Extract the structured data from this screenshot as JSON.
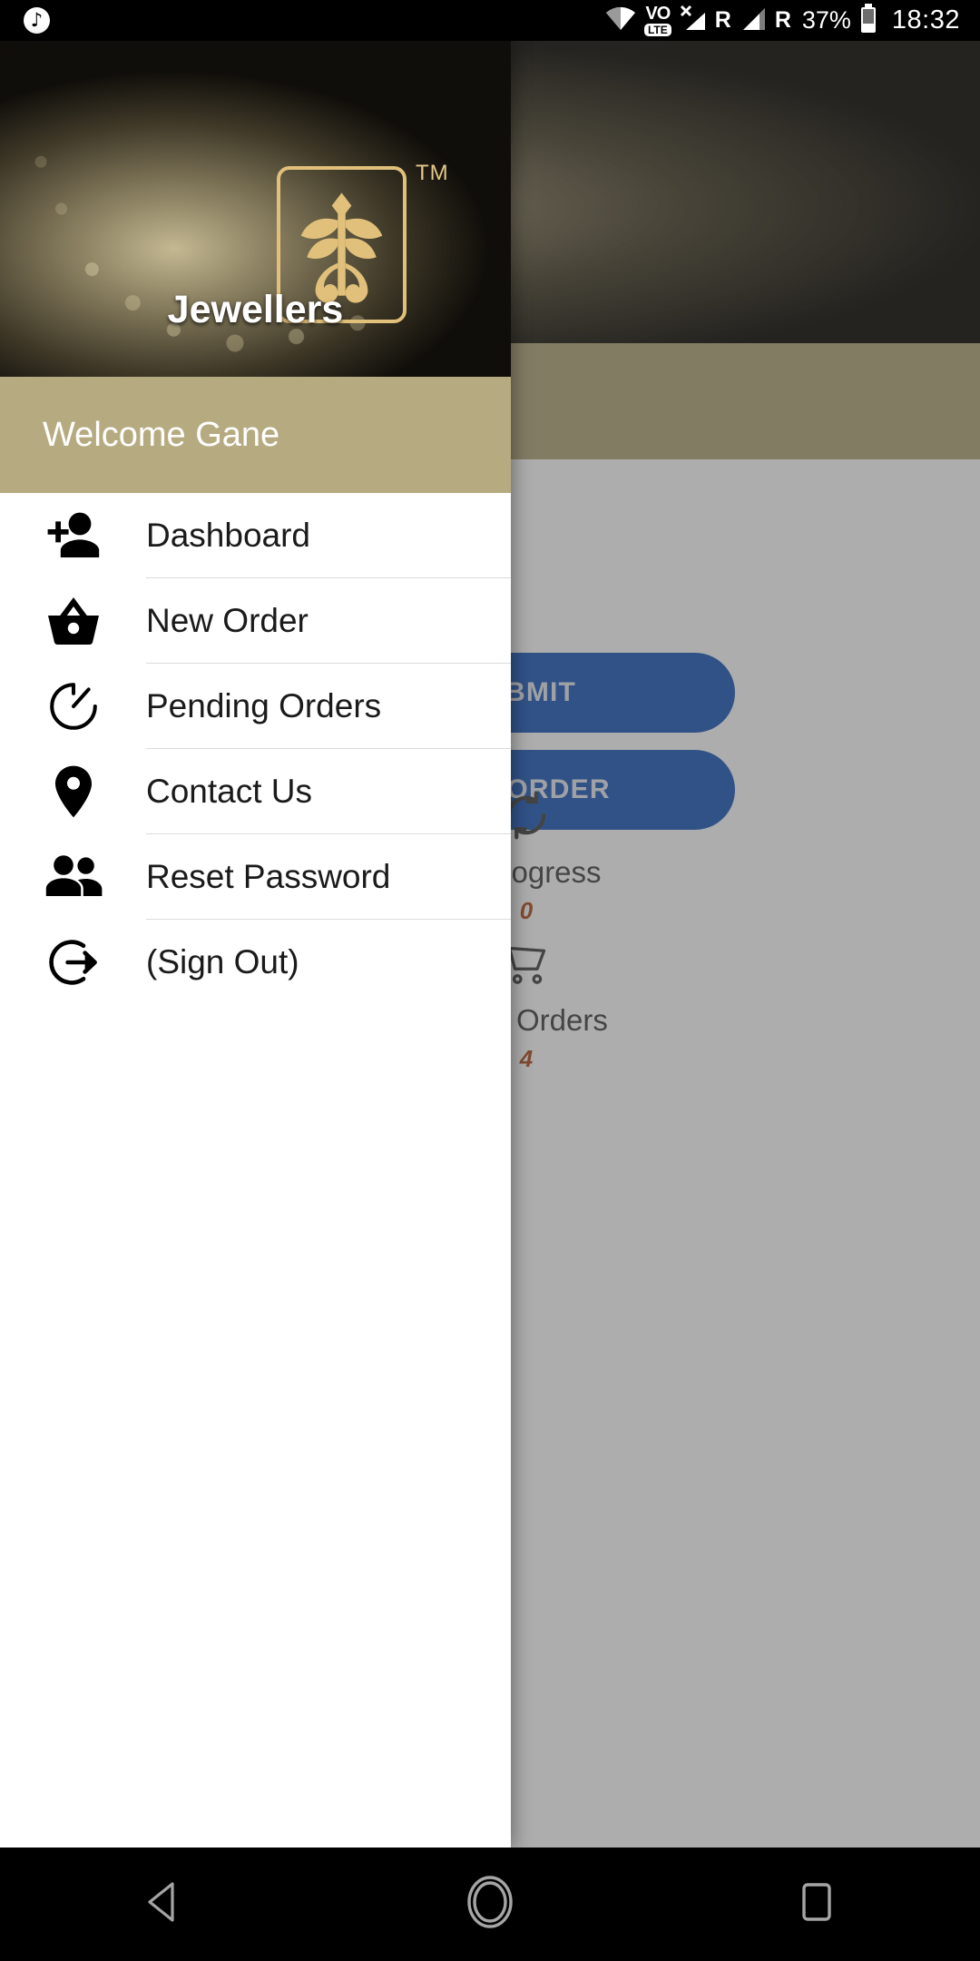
{
  "statusbar": {
    "music_icon": "music-note-icon",
    "wifi_icon": "wifi-icon",
    "volte_top": "VO",
    "volte_bottom": "LTE",
    "signal1_icon": "signal-no-service-icon",
    "roaming1": "R",
    "signal2_icon": "signal-bars-icon",
    "roaming2": "R",
    "battery_percent": "37%",
    "battery_icon": "battery-icon",
    "clock": "18:32"
  },
  "drawer": {
    "brand_name": "Jewellers",
    "trademark": "TM",
    "logo_icon": "jewellers-tree-logo-icon",
    "welcome_text": "Welcome Gane",
    "items": [
      {
        "label": "Dashboard",
        "icon": "person-add-icon"
      },
      {
        "label": "New Order",
        "icon": "shopping-basket-icon"
      },
      {
        "label": "Pending Orders",
        "icon": "timer-icon"
      },
      {
        "label": "Contact Us",
        "icon": "location-pin-icon"
      },
      {
        "label": "Reset Password",
        "icon": "people-icon"
      },
      {
        "label": "(Sign Out)",
        "icon": "sign-out-icon"
      }
    ]
  },
  "dashboard": {
    "submit_label": "SUBMIT",
    "new_order_label": "NEW ORDER",
    "stats": [
      {
        "label": "In progress",
        "value": "0",
        "icon": "sync-icon"
      },
      {
        "label": "Total Orders",
        "value": "4",
        "icon": "shopping-cart-icon"
      }
    ]
  },
  "navbar": {
    "back_icon": "back-triangle-icon",
    "home_icon": "home-circle-icon",
    "recents_icon": "recents-square-icon"
  },
  "colors": {
    "accent_blue": "#2a62bd",
    "band_khaki": "#b6ab80",
    "gold": "#e0c07a",
    "stat_value": "#b5562b"
  }
}
